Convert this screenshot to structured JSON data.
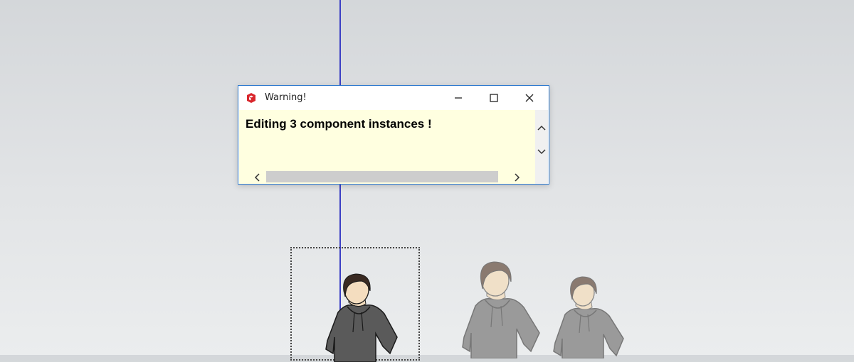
{
  "dialog": {
    "title": "Warning!",
    "message": "Editing 3 component instances !",
    "icons": {
      "app": "sketchup-icon",
      "minimize": "minimize-icon",
      "maximize": "maximize-icon",
      "close": "close-icon"
    }
  },
  "scene": {
    "figures": [
      "selected-figure",
      "figure-instance-2",
      "figure-instance-3"
    ],
    "colors": {
      "axis": "#3b3fc4",
      "dialog_border": "#2f7bd0",
      "message_background": "#ffffe0"
    }
  }
}
